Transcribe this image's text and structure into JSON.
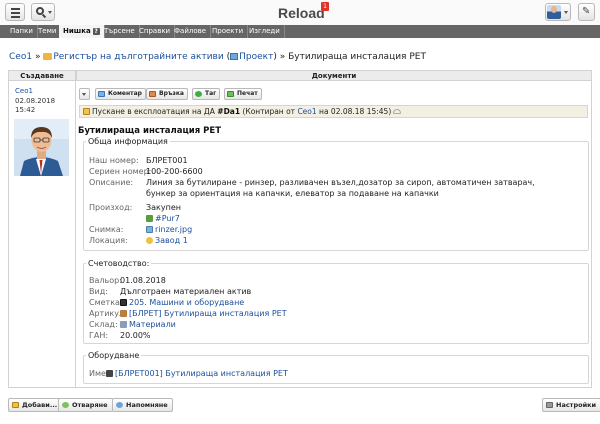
{
  "app": {
    "brand": "Reload",
    "notification_count": "1"
  },
  "tabs": [
    {
      "label": "Папки"
    },
    {
      "label": "Теми"
    },
    {
      "label": "Нишка"
    },
    {
      "label": "Търсене"
    },
    {
      "label": "Справки"
    },
    {
      "label": "Файлове"
    },
    {
      "label": "Проекти"
    },
    {
      "label": "Изгледи"
    }
  ],
  "breadcrumb": {
    "item1": "Ceo1",
    "sep": "»",
    "item2": "Регистър на дълготрайните активи",
    "item3_open": "(",
    "item3": "Проект",
    "item3_close": ")",
    "current": "Бутилираща инсталация PET"
  },
  "table": {
    "col_created": "Създаване",
    "col_documents": "Документи"
  },
  "author": {
    "name": "Ceo1",
    "date": "02.08.2018",
    "time": "15:42"
  },
  "toolbar": {
    "comment": "Коментар",
    "link": "Връзка",
    "tag": "Таг",
    "print": "Печат"
  },
  "status": {
    "prefix": "Пускане в експлоатация на ДА ",
    "doc_id": "#Da1",
    "middle": " (Контиран от ",
    "user": "Ceo1",
    "suffix": " на 02.08.18 15:45)"
  },
  "document": {
    "title": "Бутилираща инсталация PET"
  },
  "general": {
    "legend": "Обща информация",
    "our_number_label": "Наш номер:",
    "our_number": "БЛРЕТ001",
    "serial_label": "Сериен номер:",
    "serial": "100-200-6600",
    "description_label": "Описание:",
    "description_line1": "Линия за бутилиране - ринзер, разливачен възел,дозатор за сироп, автоматичен затварач,",
    "description_line2": "бункер за ориентация на капачки, елеватор за подаване на капачки",
    "origin_label": "Произход:",
    "origin": "Закупен",
    "purchase_link": "#Pur7",
    "image_label": "Снимка:",
    "image": "rinzer.jpg",
    "location_label": "Локация:",
    "location": "Завод 1"
  },
  "accounting": {
    "legend": "Счетоводство:",
    "date_label": "Вальор:",
    "date": "01.08.2018",
    "type_label": "Вид:",
    "type": "Дълготраен материален актив",
    "account_label": "Сметка:",
    "account": "205. Машини и оборудване",
    "article_label": "Артикул:",
    "article": "[БЛРЕТ] Бутилираща инсталация PET",
    "warehouse_label": "Склад:",
    "warehouse": "Материали",
    "gan_label": "ГАН:",
    "gan": "20.00%"
  },
  "equipment": {
    "legend": "Оборудване",
    "name_label": "Име:",
    "name": "[БЛРЕТ001] Бутилираща инсталация PET"
  },
  "bottom": {
    "add": "Добави...",
    "open": "Отваряне",
    "remind": "Напомняне",
    "settings": "Настройки"
  },
  "colors": {
    "link": "#1b4f9c",
    "tabbar": "#666666",
    "status_bg": "#f3efe3"
  }
}
